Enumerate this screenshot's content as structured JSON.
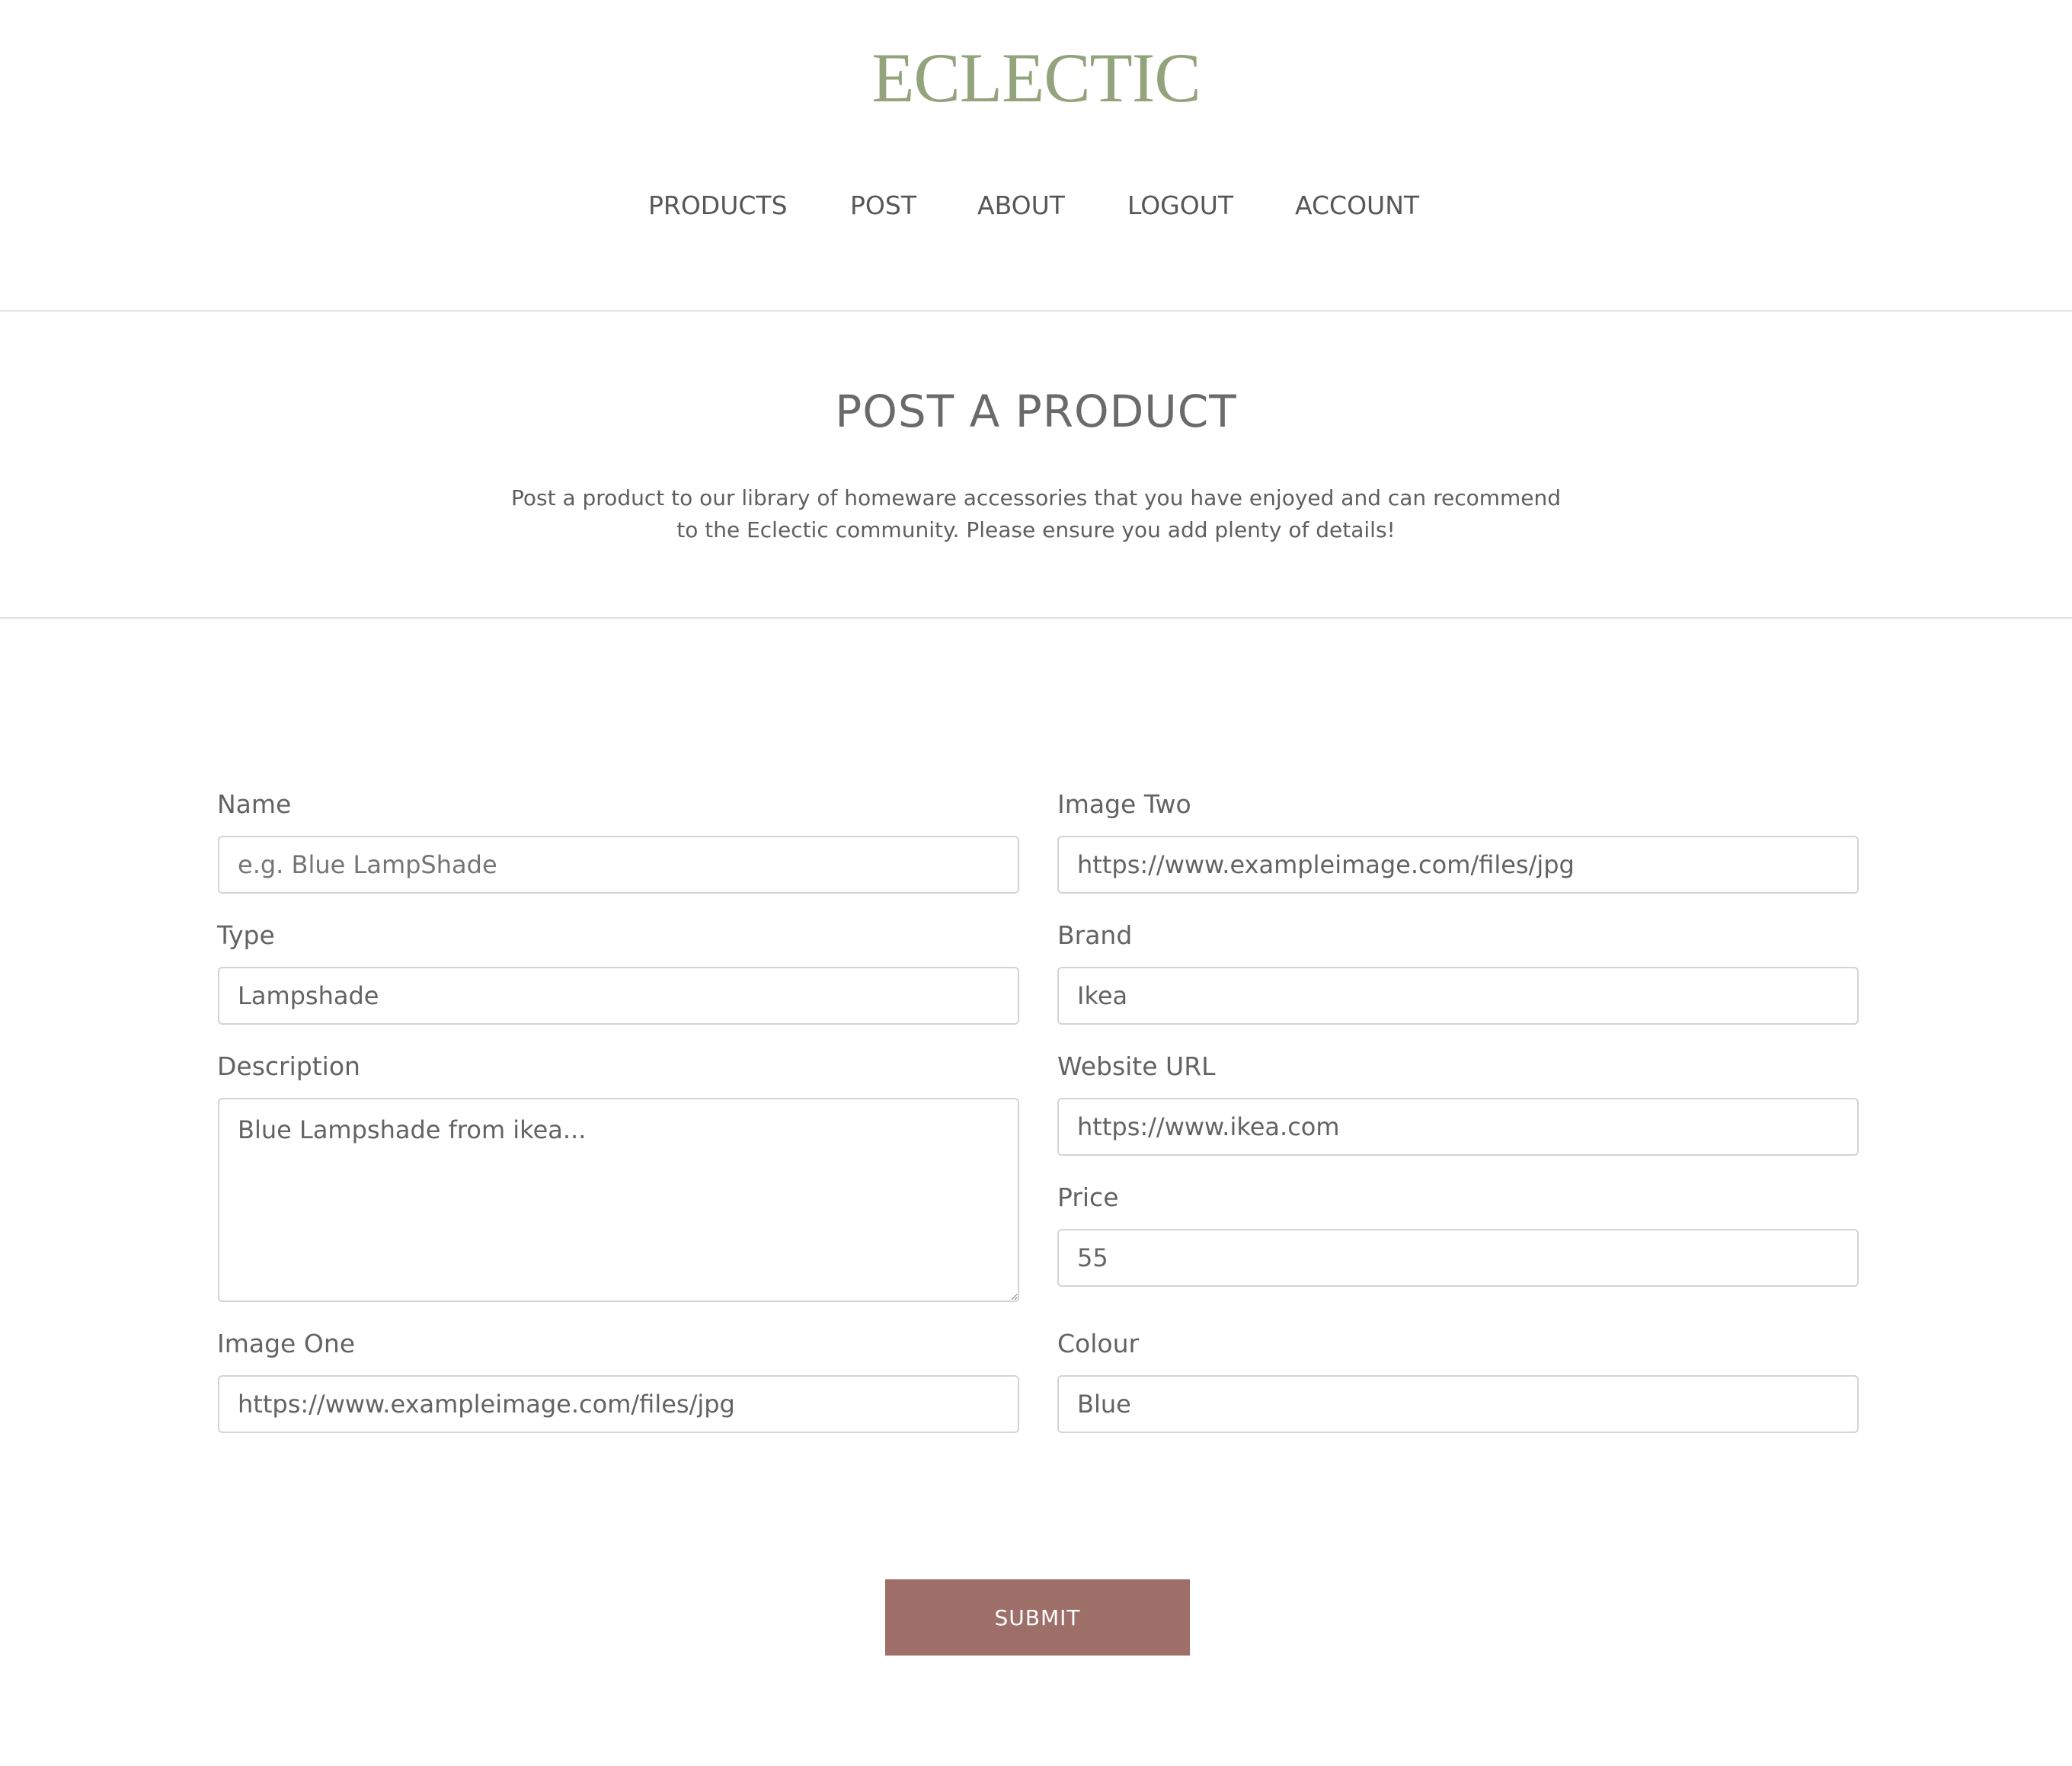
{
  "brand": {
    "name": "ECLECTIC",
    "color": "#93a47d"
  },
  "nav": {
    "items": [
      {
        "label": "PRODUCTS"
      },
      {
        "label": "POST"
      },
      {
        "label": "ABOUT"
      },
      {
        "label": "LOGOUT"
      },
      {
        "label": "ACCOUNT"
      }
    ]
  },
  "page": {
    "title": "POST A PRODUCT",
    "intro_line1": "Post a product to our library of homeware accessories that you have enjoyed and can recommend",
    "intro_line2": "to the Eclectic community. Please ensure you add plenty of details!"
  },
  "form": {
    "name": {
      "label": "Name",
      "placeholder": "e.g. Blue LampShade",
      "value": ""
    },
    "type": {
      "label": "Type",
      "value": "Lampshade"
    },
    "description": {
      "label": "Description",
      "value": "Blue Lampshade from ikea..."
    },
    "image_one": {
      "label": "Image One",
      "value": "https://www.exampleimage.com/files/jpg"
    },
    "image_two": {
      "label": "Image Two",
      "value": "https://www.exampleimage.com/files/jpg"
    },
    "brand": {
      "label": "Brand",
      "value": "Ikea"
    },
    "website_url": {
      "label": "Website URL",
      "value": "https://www.ikea.com"
    },
    "price": {
      "label": "Price",
      "value": "55"
    },
    "colour": {
      "label": "Colour",
      "value": "Blue"
    },
    "submit_label": "SUBMIT",
    "submit_color": "#9e6e69"
  }
}
